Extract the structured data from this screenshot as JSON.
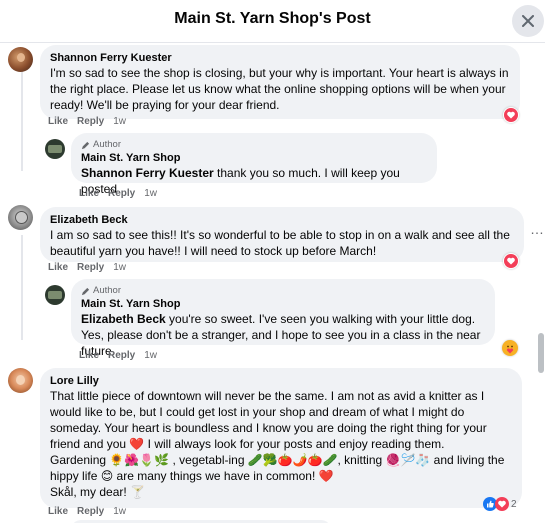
{
  "header": {
    "title": "Main St. Yarn Shop's Post"
  },
  "actions": {
    "like": "Like",
    "reply": "Reply"
  },
  "comments": [
    {
      "author": "Shannon Ferry Kuester",
      "text": "I'm so sad to see the shop is closing, but your why is important. Your heart is always in the right place. Please let us know what the online shopping options will be when your ready! We'll be praying for your dear friend.",
      "time": "1w",
      "reaction": "heart"
    },
    {
      "badge": "Author",
      "author": "Main St. Yarn Shop",
      "mention": "Shannon Ferry Kuester",
      "text": " thank you so much. I will keep you posted",
      "time": "1w"
    },
    {
      "author": "Elizabeth Beck",
      "text": "I am so sad to see this!! It's so wonderful to be able to stop in on a walk and see all the beautiful yarn you have!! I will need to stock up before March!",
      "time": "1w",
      "reaction": "heart"
    },
    {
      "badge": "Author",
      "author": "Main St. Yarn Shop",
      "mention": "Elizabeth Beck",
      "text": " you're so sweet. I've seen you walking with your little dog. Yes, please don't be a stranger, and I hope to see you in a class in the near future.",
      "time": "1w",
      "reaction": "care"
    },
    {
      "author": "Lore Lilly",
      "lines": [
        "That little piece of downtown will never be the same. I am not as avid a knitter as I",
        "would like to be, but I could get lost in your shop and dream of what I might do",
        "someday. Your heart is boundless and I know you are doing the right thing for your",
        "friend and you ❤️ I will always look for your posts and enjoy reading them.",
        "Gardening 🌻🌺🌷🌿 , vegetabl-ing 🥒🥦🍅🌶️🍅🥒, knitting 🧶🪡🧦  and living the",
        "hippy life 😊 are many things we have in common! ❤️",
        "Skål, my dear! 🍸"
      ],
      "time": "1w",
      "reaction_count": "2"
    }
  ]
}
